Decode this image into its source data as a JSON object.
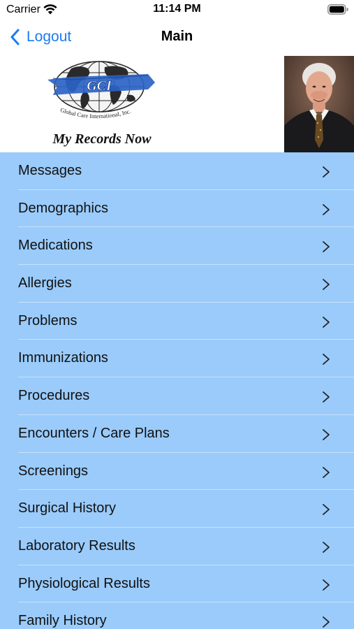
{
  "status_bar": {
    "carrier": "Carrier",
    "time": "11:14 PM",
    "icons": [
      "wifi-icon",
      "battery-icon"
    ]
  },
  "nav": {
    "back_label": "Logout",
    "title": "Main",
    "accent_color": "#1a7cf0"
  },
  "header": {
    "logo_text": "GCI",
    "logo_subtext": "Global Care International, Inc.",
    "tagline": "My Records Now"
  },
  "menu": {
    "background_color": "#9acbfb",
    "items": [
      {
        "label": "Messages"
      },
      {
        "label": "Demographics"
      },
      {
        "label": "Medications"
      },
      {
        "label": "Allergies"
      },
      {
        "label": "Problems"
      },
      {
        "label": "Immunizations"
      },
      {
        "label": "Procedures"
      },
      {
        "label": "Encounters / Care Plans"
      },
      {
        "label": "Screenings"
      },
      {
        "label": "Surgical History"
      },
      {
        "label": "Laboratory Results"
      },
      {
        "label": "Physiological Results"
      },
      {
        "label": "Family History"
      }
    ]
  }
}
